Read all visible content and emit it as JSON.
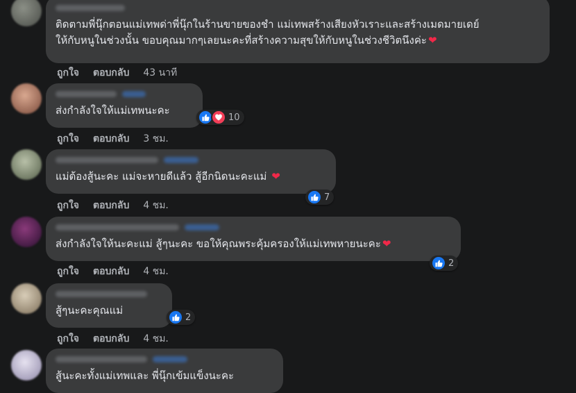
{
  "comments": [
    {
      "text_line1": "ติดตามพี่นุ๊กตอนแม่เทพด่าพี่นุ๊กในร้านขายของชำ แม่เทพสร้างเสียงหัวเราะและสร้างเมดมายเดย์",
      "text_line2": "ให้กับหนูในช่วงนั้น ขอบคุณมากๆเลยนะคะที่สร้างความสุขให้กับหนูในช่วงชีวิตนึงค่ะ",
      "has_heart": true,
      "like_label": "ถูกใจ",
      "reply_label": "ตอบกลับ",
      "time": "43 นาที"
    },
    {
      "text": "ส่งกำลังใจให้แม่เทพนะคะ",
      "like_label": "ถูกใจ",
      "reply_label": "ตอบกลับ",
      "time": "3 ชม.",
      "reactions": {
        "types": [
          "like-icon",
          "love-icon"
        ],
        "count": "10"
      }
    },
    {
      "text": "แม่ต้องสู้นะคะ แม่จะหายดีแล้ว สู้อีกนิดนะคะแม่ ",
      "has_heart": true,
      "like_label": "ถูกใจ",
      "reply_label": "ตอบกลับ",
      "time": "4 ชม.",
      "reactions": {
        "types": [
          "like-icon"
        ],
        "count": "7"
      }
    },
    {
      "text": "ส่งกำลังใจให้นะคะแม่ สู้ๆนะคะ ขอให้คุณพระคุ้มครองให้แม่เทพหายนะคะ",
      "has_heart": true,
      "like_label": "ถูกใจ",
      "reply_label": "ตอบกลับ",
      "time": "4 ชม.",
      "reactions": {
        "types": [
          "like-icon"
        ],
        "count": "2"
      }
    },
    {
      "text": "สู้ๆนะคะคุณแม่",
      "like_label": "ถูกใจ",
      "reply_label": "ตอบกลับ",
      "time": "4 ชม.",
      "reactions": {
        "types": [
          "like-icon"
        ],
        "count": "2"
      }
    },
    {
      "text": "สู้นะคะทั้งแม่เทพและ พี่นุ๊กเข้มแข็งนะคะ"
    }
  ],
  "colors": {
    "background": "#18191a",
    "bubble": "#3a3b3c",
    "text": "#e4e6eb",
    "secondary_text": "#b0b3b8",
    "like_blue": "#1877f2",
    "heart_red": "#f33e58"
  }
}
